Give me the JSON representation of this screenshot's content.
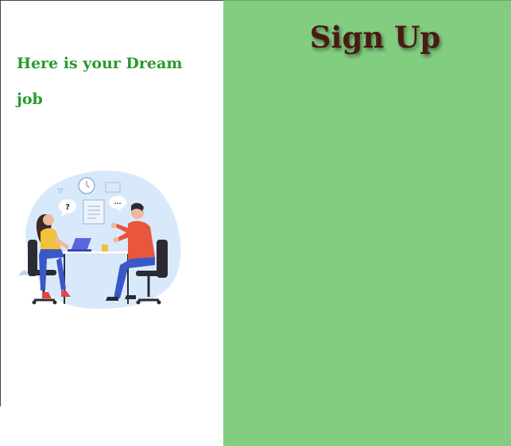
{
  "hero": {
    "tagline": "Here is your Dream job"
  },
  "signup": {
    "title": "Sign Up"
  },
  "illustration": {
    "icon": "job-interview-illustration",
    "bubble_question": "?",
    "bubble_dots": "..."
  },
  "colors": {
    "left_background": "#ffffff",
    "right_background": "#83cd80",
    "tagline": "#2a9a2a",
    "title": "#4a1a14"
  }
}
